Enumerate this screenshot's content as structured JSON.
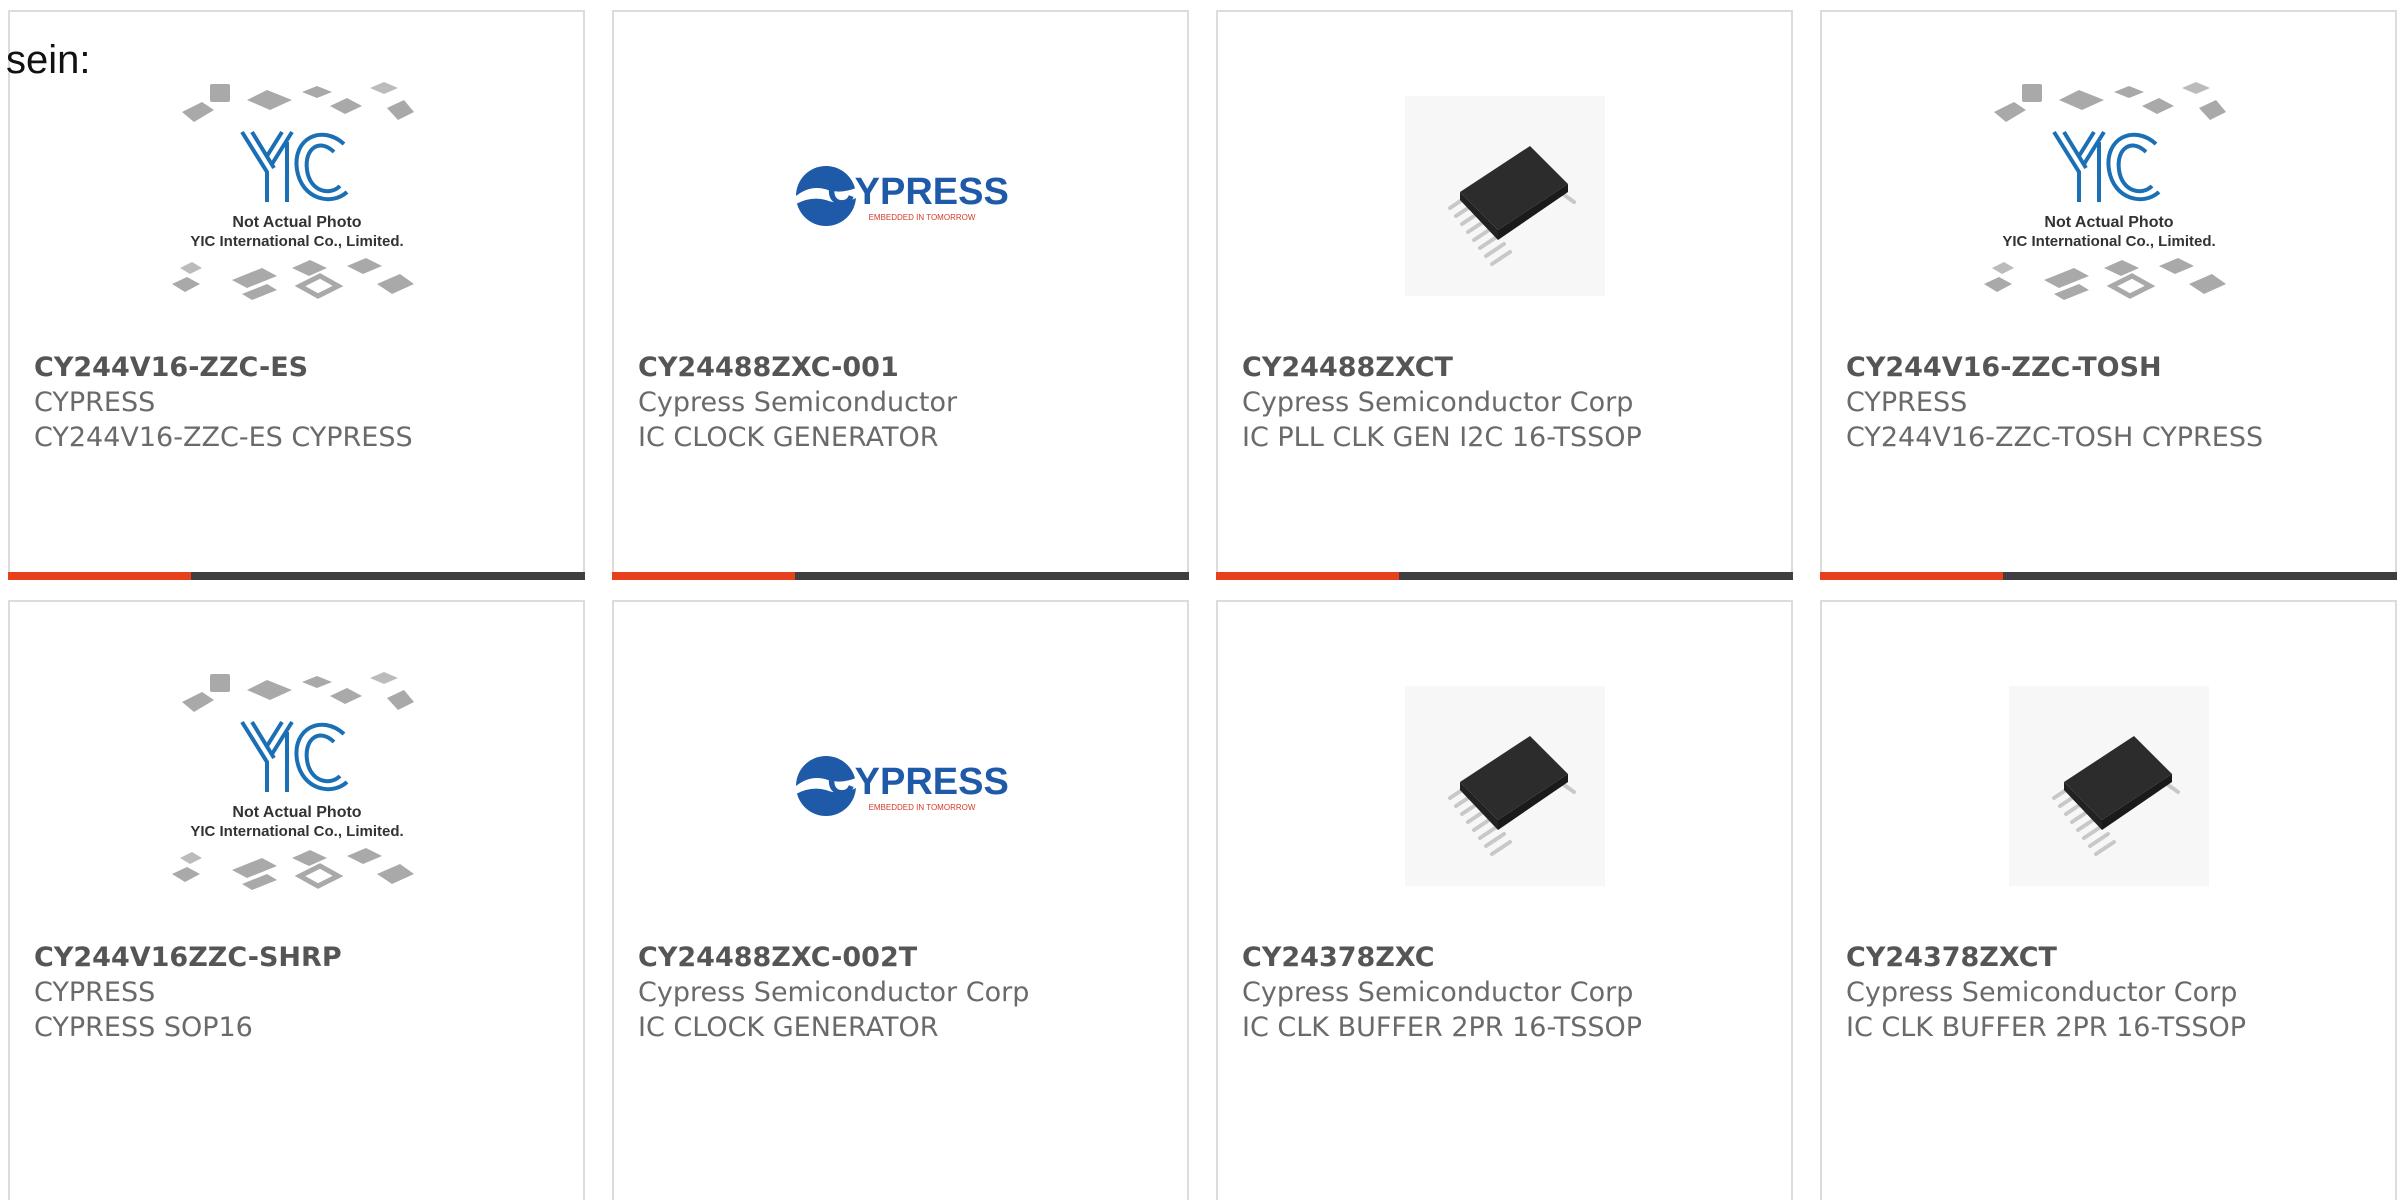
{
  "intro_text": "sein:",
  "colors": {
    "accent": "#e8401c",
    "bar": "#3f3f3f",
    "yic_blue": "#1b6fb4",
    "cypress_blue": "#1e5aa8"
  },
  "yic_placeholder": {
    "line1": "Not Actual Photo",
    "line2": "YIC International Co., Limited."
  },
  "cypress_logo": {
    "name": "CYPRESS",
    "tagline": "EMBEDDED IN TOMORROW"
  },
  "products": [
    {
      "part": "CY244V16-ZZC-ES",
      "manufacturer": "CYPRESS",
      "description": "CY244V16-ZZC-ES CYPRESS",
      "image": "yic-placeholder"
    },
    {
      "part": "CY24488ZXC-001",
      "manufacturer": "Cypress Semiconductor",
      "description": "IC CLOCK GENERATOR",
      "image": "cypress-logo"
    },
    {
      "part": "CY24488ZXCT",
      "manufacturer": "Cypress Semiconductor Corp",
      "description": "IC PLL CLK GEN I2C 16-TSSOP",
      "image": "tssop-chip"
    },
    {
      "part": "CY244V16-ZZC-TOSH",
      "manufacturer": "CYPRESS",
      "description": "CY244V16-ZZC-TOSH CYPRESS",
      "image": "yic-placeholder"
    },
    {
      "part": "CY244V16ZZC-SHRP",
      "manufacturer": "CYPRESS",
      "description": "CYPRESS SOP16",
      "image": "yic-placeholder"
    },
    {
      "part": "CY24488ZXC-002T",
      "manufacturer": "Cypress Semiconductor Corp",
      "description": "IC CLOCK GENERATOR",
      "image": "cypress-logo"
    },
    {
      "part": "CY24378ZXC",
      "manufacturer": "Cypress Semiconductor Corp",
      "description": "IC CLK BUFFER 2PR 16-TSSOP",
      "image": "tssop-chip"
    },
    {
      "part": "CY24378ZXCT",
      "manufacturer": "Cypress Semiconductor Corp",
      "description": "IC CLK BUFFER 2PR 16-TSSOP",
      "image": "tssop-chip"
    }
  ]
}
